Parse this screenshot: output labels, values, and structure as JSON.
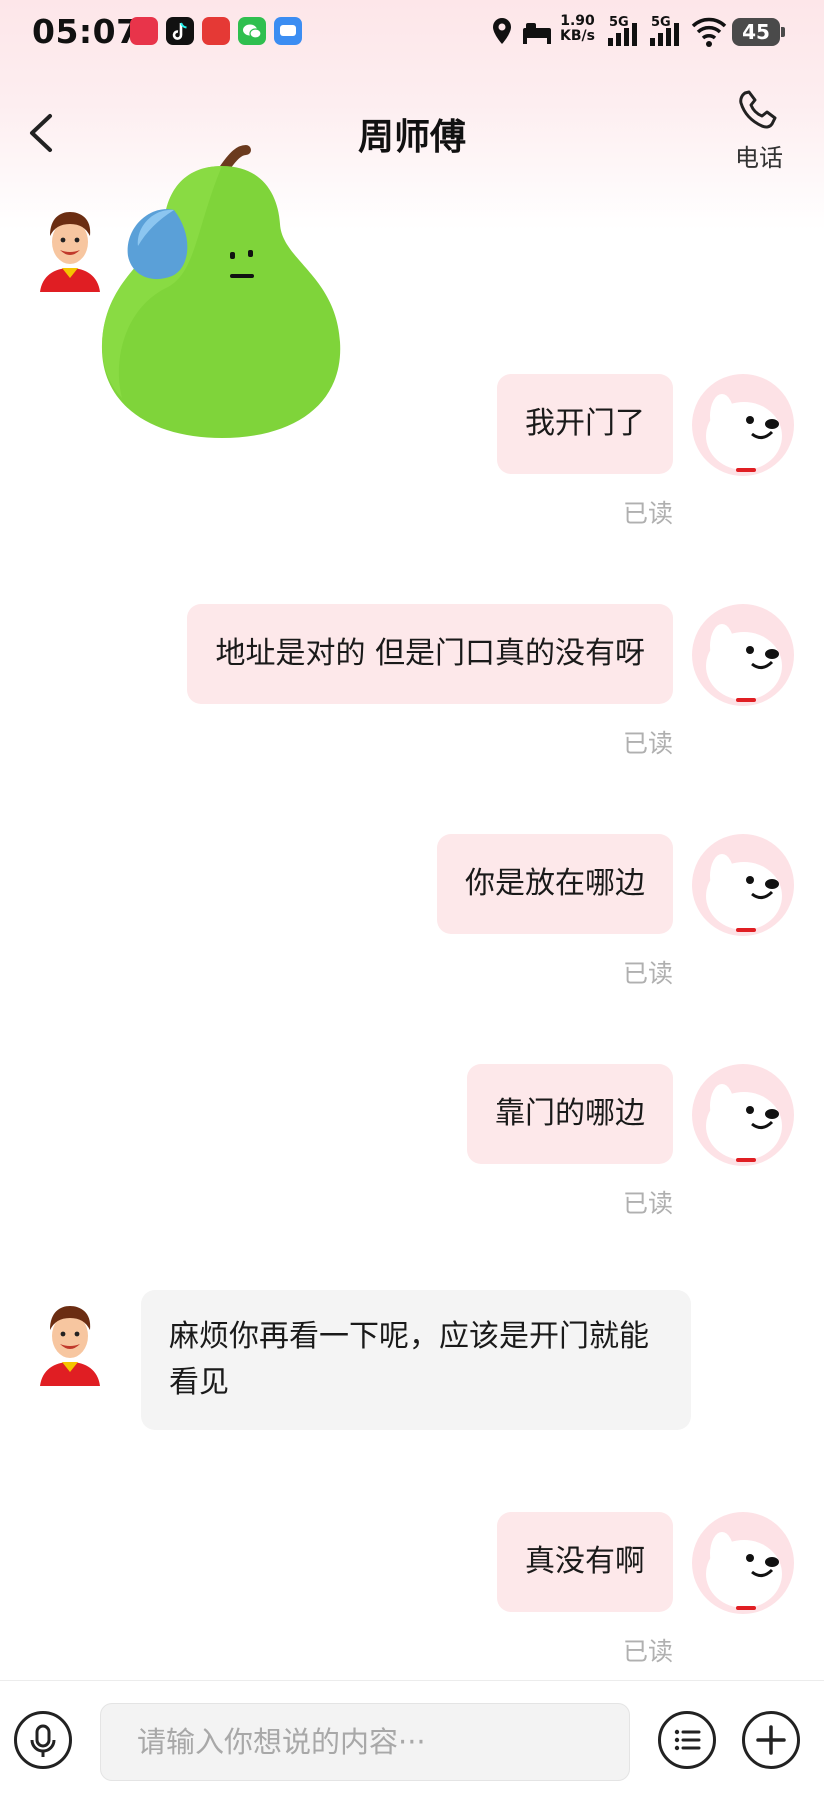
{
  "status_bar": {
    "time": "05:07",
    "speed_value": "1.90",
    "speed_unit": "KB/s",
    "sig1_label": "5G",
    "sig2_label": "5G",
    "battery": "45"
  },
  "header": {
    "title": "周师傅",
    "phone_label": "电话",
    "back_icon": "chevron-left-icon",
    "phone_icon": "phone-icon"
  },
  "messages": [
    {
      "side": "left",
      "type": "sticker",
      "sticker": "pear-sweat-sticker"
    },
    {
      "side": "right",
      "text": "我开门了",
      "status": "已读"
    },
    {
      "side": "right",
      "text": "地址是对的 但是门口真的没有呀",
      "status": "已读"
    },
    {
      "side": "right",
      "text": "你是放在哪边",
      "status": "已读"
    },
    {
      "side": "right",
      "text": "靠门的哪边",
      "status": "已读"
    },
    {
      "side": "left",
      "text": "麻烦你再看一下呢，应该是开门就能看见"
    },
    {
      "side": "right",
      "text": "真没有啊",
      "status": "已读"
    }
  ],
  "input_bar": {
    "placeholder": "请输入你想说的内容···",
    "voice_icon": "microphone-icon",
    "menu_icon": "list-icon",
    "add_icon": "plus-icon"
  },
  "colors": {
    "header_bg": "#fde6e9",
    "sent_bubble": "#fde8ea",
    "received_bubble": "#f4f4f4",
    "read_status": "#b0b0b0"
  }
}
